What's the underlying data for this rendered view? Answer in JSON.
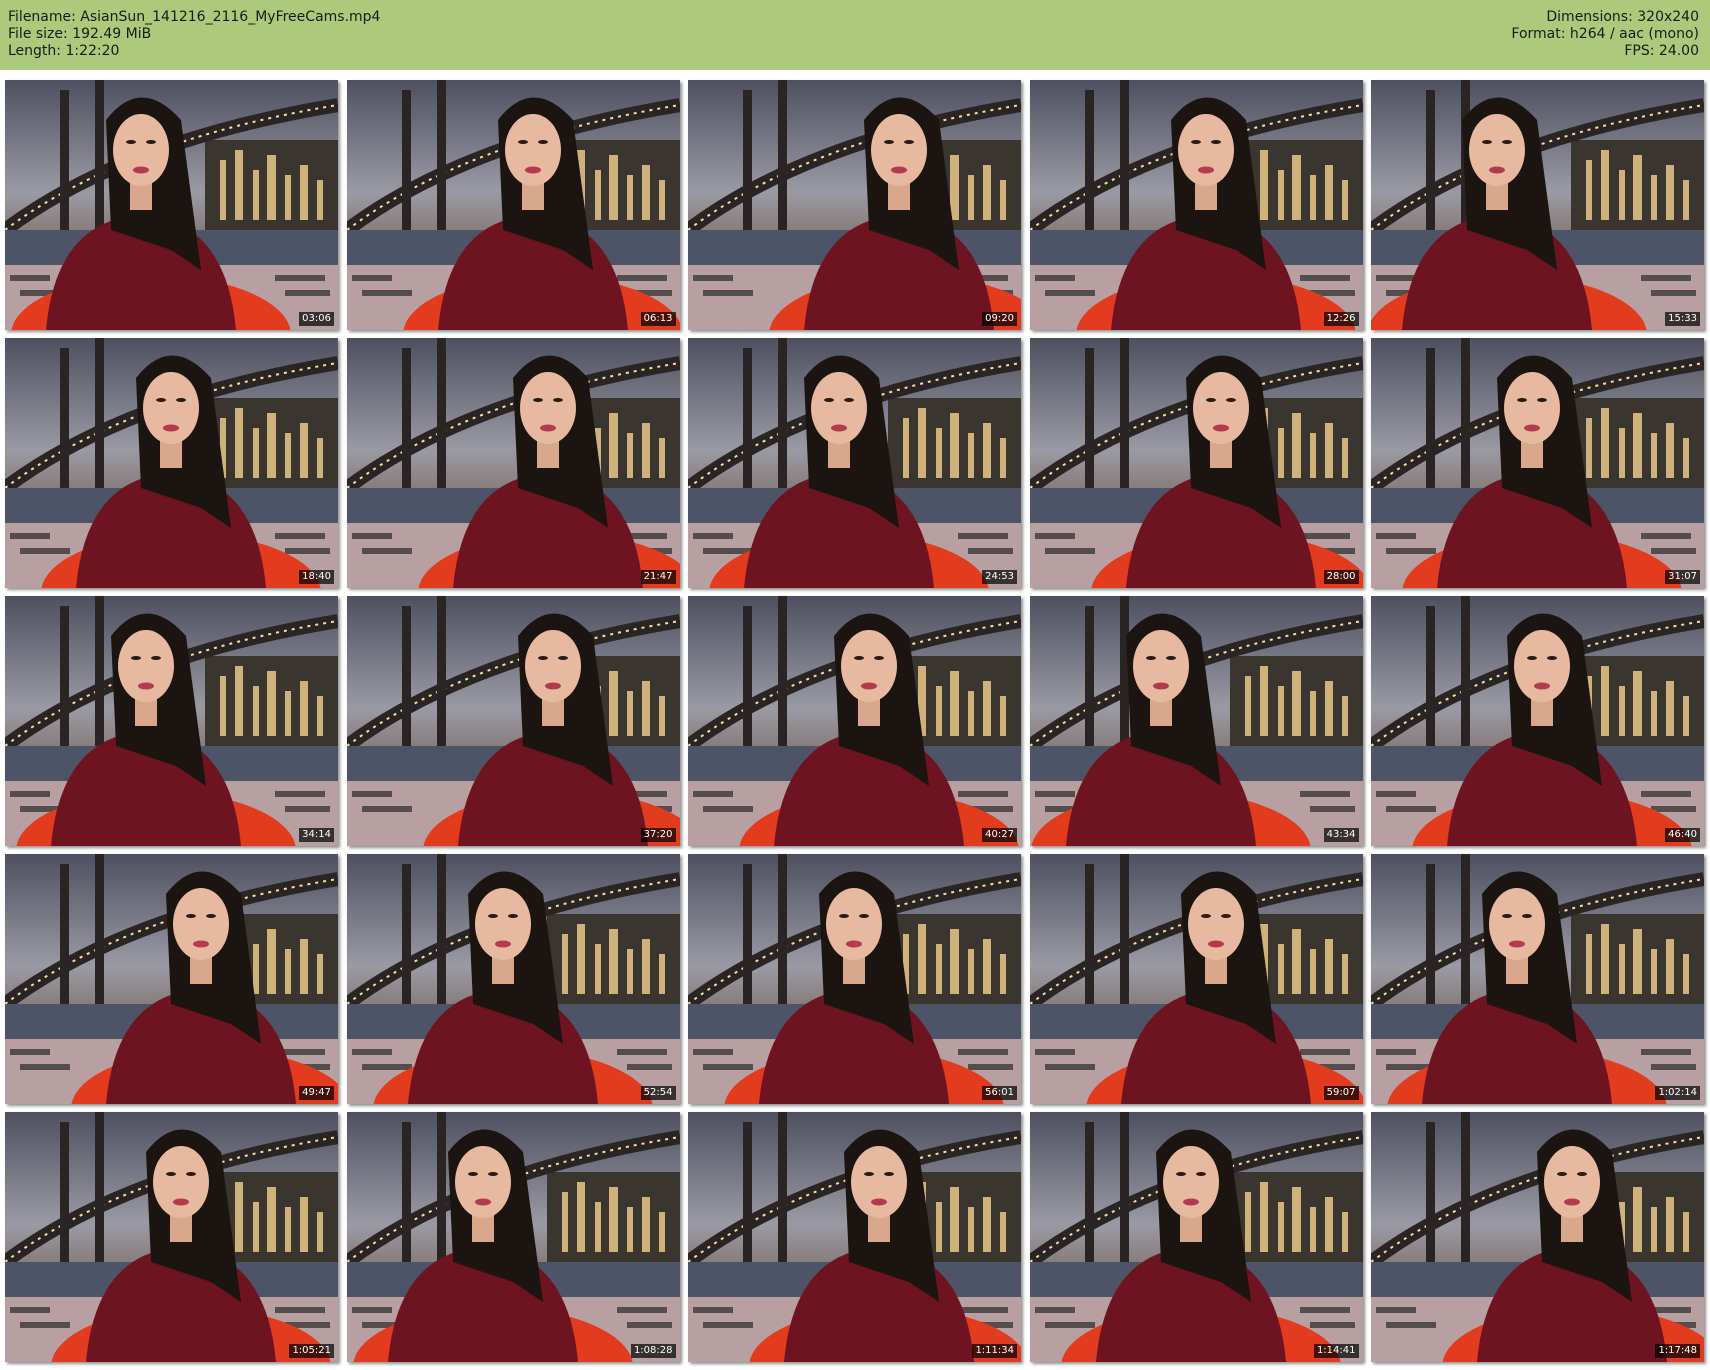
{
  "header": {
    "filename": "Filename: AsianSun_141216_2116_MyFreeCams.mp4",
    "filesize": "File size: 192.49 MiB",
    "length": "Length: 1:22:20",
    "dimensions": "Dimensions: 320x240",
    "format": "Format: h264 / aac (mono)",
    "fps": "FPS: 24.00"
  },
  "colors": {
    "header_bg": "#acc97c",
    "sweater": "#6e1420",
    "beanbag": "#e23b1d",
    "sky": "#7d7f8e"
  },
  "thumbnails": [
    {
      "time": "03:06"
    },
    {
      "time": "06:13"
    },
    {
      "time": "09:20"
    },
    {
      "time": "12:26"
    },
    {
      "time": "15:33"
    },
    {
      "time": "18:40"
    },
    {
      "time": "21:47"
    },
    {
      "time": "24:53"
    },
    {
      "time": "28:00"
    },
    {
      "time": "31:07"
    },
    {
      "time": "34:14"
    },
    {
      "time": "37:20"
    },
    {
      "time": "40:27"
    },
    {
      "time": "43:34"
    },
    {
      "time": "46:40"
    },
    {
      "time": "49:47"
    },
    {
      "time": "52:54"
    },
    {
      "time": "56:01"
    },
    {
      "time": "59:07"
    },
    {
      "time": "1:02:14"
    },
    {
      "time": "1:05:21"
    },
    {
      "time": "1:08:28"
    },
    {
      "time": "1:11:34"
    },
    {
      "time": "1:14:41"
    },
    {
      "time": "1:17:48"
    }
  ]
}
